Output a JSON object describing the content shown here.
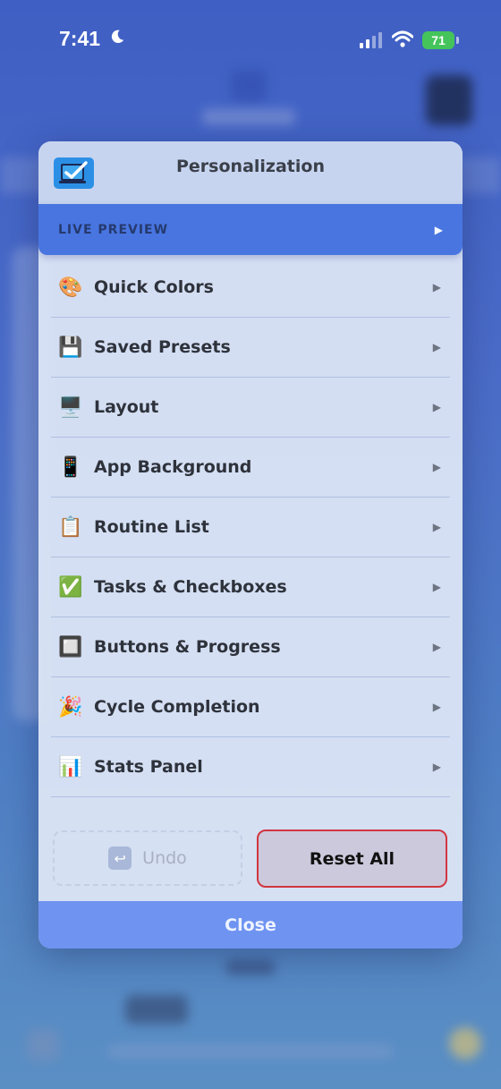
{
  "status_bar": {
    "time": "7:41",
    "battery": "71"
  },
  "modal": {
    "title": "Personalization",
    "live_preview": {
      "label": "LIVE PREVIEW",
      "arrow": "▶"
    },
    "menu_items": [
      {
        "label": "Quick Colors",
        "icon": "palette-icon",
        "glyph": "🎨",
        "arrow": "▶"
      },
      {
        "label": "Saved Presets",
        "icon": "floppy-disk-icon",
        "glyph": "💾",
        "arrow": "▶"
      },
      {
        "label": "Layout",
        "icon": "monitor-icon",
        "glyph": "🖥️",
        "arrow": "▶"
      },
      {
        "label": "App Background",
        "icon": "phone-icon",
        "glyph": "📱",
        "arrow": "▶"
      },
      {
        "label": "Routine List",
        "icon": "notepad-icon",
        "glyph": "📋",
        "arrow": "▶"
      },
      {
        "label": "Tasks & Checkboxes",
        "icon": "check-mark-icon",
        "glyph": "✅",
        "arrow": "▶"
      },
      {
        "label": "Buttons & Progress",
        "icon": "square-button-icon",
        "glyph": "🔲",
        "arrow": "▶"
      },
      {
        "label": "Cycle Completion",
        "icon": "party-popper-icon",
        "glyph": "🎉",
        "arrow": "▶"
      },
      {
        "label": "Stats Panel",
        "icon": "bar-chart-icon",
        "glyph": "📊",
        "arrow": "▶"
      }
    ],
    "undo_label": "Undo",
    "undo_icon": "↩",
    "reset_label": "Reset All",
    "close_label": "Close"
  },
  "colors": {
    "accent": "#4875e0",
    "close_bar": "#6e93f1",
    "reset_border": "#d2353f",
    "battery": "#44c45a"
  }
}
